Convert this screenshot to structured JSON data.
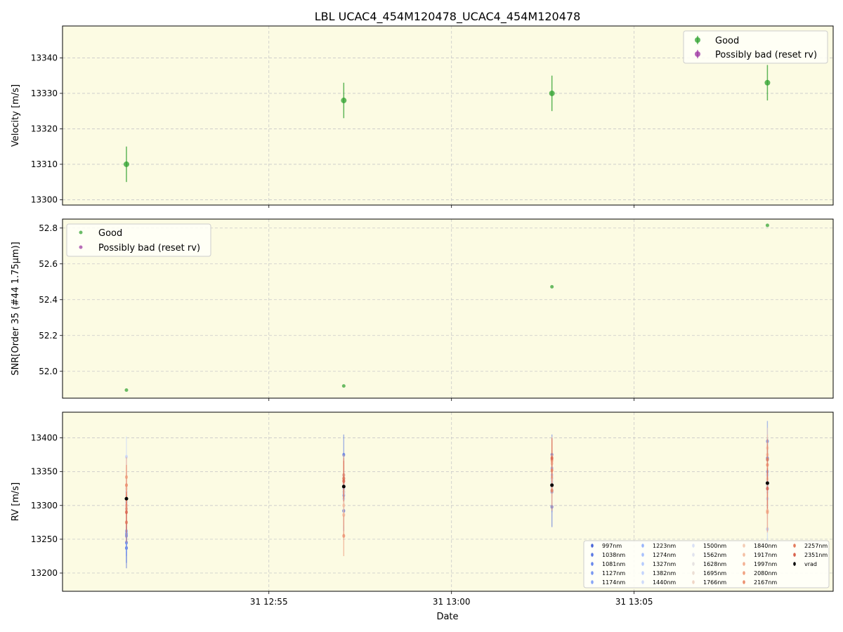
{
  "figure": {
    "title": "LBL UCAC4_454M120478_UCAC4_454M120478",
    "xlabel": "Date",
    "x_ticks": [
      {
        "t": 55,
        "label": "31 12:55"
      },
      {
        "t": 60,
        "label": "31 13:00"
      },
      {
        "t": 65,
        "label": "31 13:05"
      }
    ],
    "background": "#fcfbe3",
    "grid": true
  },
  "chart_data": [
    {
      "type": "scatter",
      "panel": "velocity",
      "ylabel": "Velocity [m/s]",
      "ylim": [
        13298.5,
        13349
      ],
      "y_ticks": [
        13300,
        13310,
        13320,
        13330,
        13340
      ],
      "x_unit_note": "minutes after 12:00 on day 31",
      "legend": {
        "placement": "top-right",
        "entries": [
          "Good",
          "Possibly bad (reset rv)"
        ]
      },
      "series": [
        {
          "name": "Good",
          "color": "#2ca02c",
          "points": [
            {
              "x": 51.1,
              "y": 13310,
              "err": 5
            },
            {
              "x": 57.05,
              "y": 13328,
              "err": 5
            },
            {
              "x": 62.75,
              "y": 13330,
              "err": 5
            },
            {
              "x": 68.65,
              "y": 13333,
              "err": 5
            }
          ]
        },
        {
          "name": "Possibly bad (reset rv)",
          "color": "#9b30a0",
          "points": []
        }
      ]
    },
    {
      "type": "scatter",
      "panel": "snr",
      "ylabel": "SNR[Order 35 (#44 1.75μm)]",
      "ylim": [
        51.85,
        52.85
      ],
      "y_ticks": [
        52.0,
        52.2,
        52.4,
        52.6,
        52.8
      ],
      "legend": {
        "placement": "top-left",
        "entries": [
          "Good",
          "Possibly bad (reset rv)"
        ]
      },
      "series": [
        {
          "name": "Good",
          "color": "#2ca02c",
          "points": [
            {
              "x": 51.1,
              "y": 51.895
            },
            {
              "x": 57.05,
              "y": 51.918
            },
            {
              "x": 62.75,
              "y": 52.472
            },
            {
              "x": 68.65,
              "y": 52.815
            }
          ]
        },
        {
          "name": "Possibly bad (reset rv)",
          "color": "#9b30a0",
          "points": []
        }
      ]
    },
    {
      "type": "scatter",
      "panel": "rv",
      "ylabel": "RV [m/s]",
      "ylim": [
        13173,
        13438
      ],
      "y_ticks": [
        13200,
        13250,
        13300,
        13350,
        13400
      ],
      "legend": {
        "placement": "bottom-right",
        "columns": 5
      },
      "epochs": [
        51.1,
        57.05,
        62.75,
        68.65
      ],
      "series": [
        {
          "name": "997nm",
          "color": "#4a66d9",
          "y": [
            13237,
            13292,
            13298,
            13370
          ]
        },
        {
          "name": "1038nm",
          "color": "#5a78e3",
          "y": [
            13245,
            13375,
            13375,
            13368
          ]
        },
        {
          "name": "1081nm",
          "color": "#6887ec",
          "y": [
            13255,
            13340,
            13320,
            13395
          ]
        },
        {
          "name": "1127nm",
          "color": "#7897f2",
          "y": [
            13258,
            13320,
            13340,
            13330
          ]
        },
        {
          "name": "1174nm",
          "color": "#88a6f7",
          "y": [
            13262,
            13315,
            13355,
            13350
          ]
        },
        {
          "name": "1223nm",
          "color": "#98b4fb",
          "y": [
            13295,
            13345,
            13328,
            13325
          ]
        },
        {
          "name": "1274nm",
          "color": "#a7c0fd",
          "y": [
            13305,
            13330,
            13322,
            13345
          ]
        },
        {
          "name": "1327nm",
          "color": "#b5cbfe",
          "y": [
            13300,
            13325,
            13345,
            13265
          ]
        },
        {
          "name": "1382nm",
          "color": "#c3d4fd",
          "y": [
            13372,
            13310,
            13335,
            13310
          ]
        },
        {
          "name": "1440nm",
          "color": "#cfdbfa",
          "y": [
            13310,
            13318,
            13330,
            13335
          ]
        },
        {
          "name": "1500nm",
          "color": "#d9e0f5",
          "y": [
            13320,
            13330,
            13340,
            13345
          ]
        },
        {
          "name": "1562nm",
          "color": "#e1e3ee",
          "y": [
            13305,
            13335,
            13332,
            13320
          ]
        },
        {
          "name": "1628nm",
          "color": "#e7e3e2",
          "y": [
            13315,
            13320,
            13338,
            13330
          ]
        },
        {
          "name": "1695nm",
          "color": "#ecdfd5",
          "y": [
            13325,
            13332,
            13326,
            13340
          ]
        },
        {
          "name": "1766nm",
          "color": "#f0d6c6",
          "y": [
            13308,
            13336,
            13342,
            13338
          ]
        },
        {
          "name": "1840nm",
          "color": "#f3ccb6",
          "y": [
            13330,
            13340,
            13372,
            13385
          ]
        },
        {
          "name": "1917nm",
          "color": "#f4bfa4",
          "y": [
            13300,
            13300,
            13362,
            13375
          ]
        },
        {
          "name": "1997nm",
          "color": "#f3b193",
          "y": [
            13295,
            13286,
            13366,
            13292
          ]
        },
        {
          "name": "2080nm",
          "color": "#f0a181",
          "y": [
            13342,
            13345,
            13368,
            13290
          ]
        },
        {
          "name": "2167nm",
          "color": "#eb8f6f",
          "y": [
            13330,
            13255,
            13352,
            13360
          ]
        },
        {
          "name": "2257nm",
          "color": "#e37c5e",
          "y": [
            13275,
            13340,
            13322,
            13368
          ]
        },
        {
          "name": "2351nm",
          "color": "#d9624d",
          "y": [
            13290,
            13336,
            13370,
            13325
          ]
        },
        {
          "name": "vrad",
          "color": "#000000",
          "y": [
            13310,
            13328,
            13330,
            13333
          ]
        }
      ]
    }
  ]
}
